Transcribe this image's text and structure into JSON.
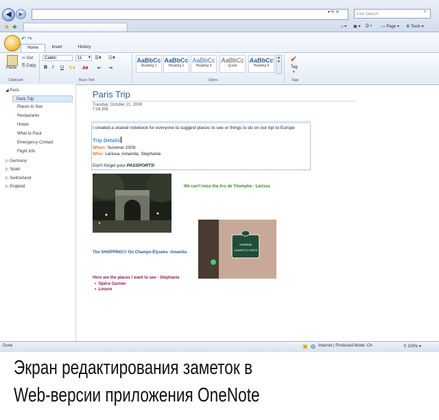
{
  "browser": {
    "search_placeholder": "Live Search",
    "toolbar": {
      "page": "Page",
      "tools": "Tools"
    },
    "status": {
      "done": "Done",
      "zone": "Internet | Protected Mode: On",
      "zoom": "100%"
    }
  },
  "ribbon": {
    "tabs": [
      "Home",
      "Insert",
      "History"
    ],
    "clipboard": {
      "paste": "Paste",
      "cut": "Cut",
      "copy": "Copy",
      "label": "Clipboard"
    },
    "font": {
      "name": "Calibri",
      "size": "11",
      "label": "Basic Text"
    },
    "styles": {
      "label": "Styles",
      "items": [
        {
          "preview": "AaBbCc",
          "name": "Heading 1"
        },
        {
          "preview": "AaBbCc",
          "name": "Heading 2"
        },
        {
          "preview": "AaBbCc",
          "name": "Heading 3"
        },
        {
          "preview": "AaBbCc",
          "name": "Quote"
        },
        {
          "preview": "AaBbCc",
          "name": "Heading 4"
        }
      ]
    },
    "tags": {
      "tag": "Tag",
      "label": "Tags"
    }
  },
  "nav": {
    "sections": [
      {
        "label": "Paris",
        "pages": [
          "Paris Trip",
          "Places to See",
          "Restaurants",
          "Hotels",
          "What to Pack",
          "Emergency Contact",
          "Flight Info"
        ]
      },
      {
        "label": "Germany"
      },
      {
        "label": "Spain"
      },
      {
        "label": "Switzerland"
      },
      {
        "label": "England"
      }
    ]
  },
  "page": {
    "title": "Paris Trip",
    "date": "Tuesday, October 21, 2008",
    "time": "7:06 PM",
    "intro": "I created a shared notebook for everyone to suggest places to see or things to do on our trpi to Europe",
    "details_heading": "Trip Details",
    "when_label": "When:",
    "when_value": "Summer 2009",
    "who_label": "Who:",
    "who_value": "Larissa, Amanda, Stephanie",
    "forget_prefix": "Don't forget your",
    "forget_word": "PASSPORTS",
    "forget_suffix": "!",
    "arc_note": "We can't miss the Arc de Triomphe - Larissa",
    "shopping_note": "The SHOPPING!!! On Champs-Élysées -Amanda",
    "sign_text_1": "AVENUE",
    "sign_text_2": "CHAMPS ÉLYSÉES",
    "places_heading": "Here are the places I want to see - Stephanie",
    "places": [
      "Opéra Garnier",
      "Louvre"
    ]
  },
  "caption": {
    "line1": "Экран редактирования заметок в",
    "line2": "Web-версии приложения OneNote"
  }
}
